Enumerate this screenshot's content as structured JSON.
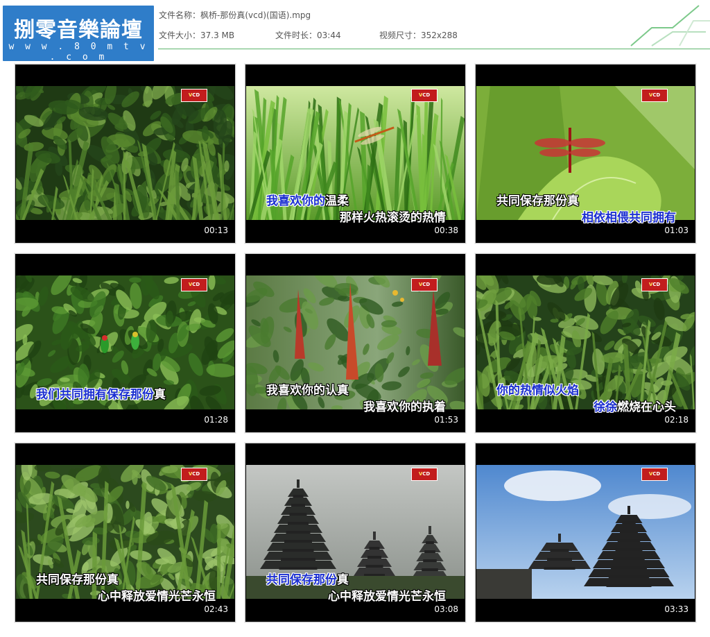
{
  "header": {
    "logo_title": "捌零音樂論壇",
    "logo_url": "w w w . 8 0 m t v . c o m",
    "file_name_label": "文件名称：",
    "file_name": "枫桥-那份真(vcd)(国语).mpg",
    "file_size_label": "文件大小：",
    "file_size": "37.3 MB",
    "duration_label": "文件时长：",
    "duration": "03:44",
    "video_size_label": "视频尺寸：",
    "video_size": "352x288"
  },
  "colors": {
    "accent": "#2f7dc9",
    "rule": "#5db56b",
    "lyric_blue": "#1b2fd0"
  },
  "thumbnails": [
    {
      "time": "00:13",
      "scene": "fern",
      "lines": []
    },
    {
      "time": "00:38",
      "scene": "dragonfly-grass",
      "lines": [
        {
          "parts": [
            {
              "t": "我喜欢你的",
              "c": "b"
            },
            {
              "t": "温柔",
              "c": "w"
            }
          ]
        },
        {
          "parts": [
            {
              "t": "那样火热滚烫的热情",
              "c": "w"
            }
          ]
        }
      ]
    },
    {
      "time": "01:03",
      "scene": "dragonfly-leaf",
      "lines": [
        {
          "parts": [
            {
              "t": "共同保存那份真",
              "c": "w"
            }
          ]
        },
        {
          "parts": [
            {
              "t": "相依相偎共同拥有",
              "c": "b"
            }
          ]
        }
      ]
    },
    {
      "time": "01:28",
      "scene": "birds",
      "lines": [
        {
          "parts": [
            {
              "t": "我们共同拥有保存那份",
              "c": "b"
            },
            {
              "t": "真",
              "c": "w"
            }
          ]
        }
      ]
    },
    {
      "time": "01:53",
      "scene": "flowers",
      "lines": [
        {
          "parts": [
            {
              "t": "我喜欢你的认真",
              "c": "w"
            }
          ]
        },
        {
          "parts": [
            {
              "t": "我喜欢你的执着",
              "c": "w"
            }
          ]
        }
      ]
    },
    {
      "time": "02:18",
      "scene": "ferns2",
      "lines": [
        {
          "parts": [
            {
              "t": "你的热情似火焰",
              "c": "b"
            }
          ]
        },
        {
          "parts": [
            {
              "t": "徐徐",
              "c": "b"
            },
            {
              "t": "燃烧在心头",
              "c": "w"
            }
          ]
        }
      ]
    },
    {
      "time": "02:43",
      "scene": "bamboo",
      "lines": [
        {
          "parts": [
            {
              "t": "共同保存那份真",
              "c": "w"
            }
          ]
        },
        {
          "parts": [
            {
              "t": "心中释放爱情光芒永恒",
              "c": "w"
            }
          ]
        }
      ]
    },
    {
      "time": "03:08",
      "scene": "pagoda-grey",
      "lines": [
        {
          "parts": [
            {
              "t": "共同保存那份",
              "c": "b"
            },
            {
              "t": "真",
              "c": "w"
            }
          ]
        },
        {
          "parts": [
            {
              "t": "心中释放爱情光芒永恒",
              "c": "w"
            }
          ]
        }
      ]
    },
    {
      "time": "03:33",
      "scene": "pagoda-blue",
      "lines": []
    }
  ]
}
